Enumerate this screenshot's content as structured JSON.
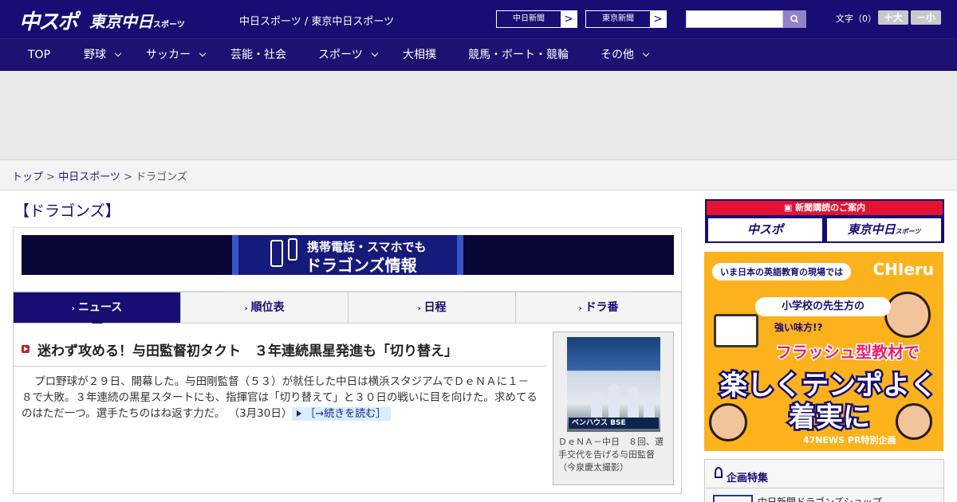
{
  "header": {
    "logo_chunichi_sports": "中スポ",
    "logo_tokyo_chunichi": "東京中日",
    "logo_tokyo_chunichi_sub": "スポーツ",
    "site_links": "中日スポーツ / 東京中日スポーツ",
    "btn_chunichi_shimbun": "中日新聞",
    "btn_tokyo_shimbun": "東京新聞",
    "btn_arrow": ">",
    "search_placeholder": "",
    "font_size_label": "文字（0）",
    "font_larger": "＋大",
    "font_smaller": "－小"
  },
  "nav": [
    {
      "label": "TOP",
      "has_menu": false
    },
    {
      "label": "野球",
      "has_menu": true
    },
    {
      "label": "サッカー",
      "has_menu": true
    },
    {
      "label": "芸能・社会",
      "has_menu": false
    },
    {
      "label": "スポーツ",
      "has_menu": true
    },
    {
      "label": "大相撲",
      "has_menu": false
    },
    {
      "label": "競馬・ボート・競輪",
      "has_menu": false
    },
    {
      "label": "その他",
      "has_menu": true
    }
  ],
  "breadcrumb": {
    "top": "トップ",
    "sep": " > ",
    "chunichi_sports": "中日スポーツ",
    "current": "ドラゴンズ"
  },
  "section_title": "【ドラゴンズ】",
  "banner": {
    "line1": "携帯電話・スマホでも",
    "line2": "ドラゴンズ情報"
  },
  "tabs": [
    {
      "label": "ニュース",
      "active": true
    },
    {
      "label": "順位表",
      "active": false
    },
    {
      "label": "日程",
      "active": false
    },
    {
      "label": "ドラ番",
      "active": false
    }
  ],
  "article": {
    "title": "迷わず攻める！与田監督初タクト　３年連続黒星発進も「切り替え」",
    "body": "プロ野球が２９日、開幕した。与田剛監督（５３）が就任した中日は横浜スタジアムでＤｅＮＡに１－８で大敗。３年連続の黒星スタートにも、指揮官は「切り替えて」と３０日の戦いに目を向けた。求めてるのはただ一つ。選手たちのはね返す力だ。",
    "date": "（3月30日）",
    "more": "［→続きを読む］",
    "photo_sign": "ベンハウス BSE",
    "caption": "ＤｅＮＡ－中日　８回、選手交代を告げる与田監督（今泉慶太撮影）"
  },
  "sidebar": {
    "subscription_header": "新聞購読のご案内",
    "sub_chunichi": "中スポ",
    "sub_tokyo": "東京中日",
    "sub_tokyo_small": "スポーツ",
    "ad": {
      "tag": "いま日本の英語教育の現場では",
      "brand": "CHIeru",
      "line1": "小学校の先生方の",
      "line2": "強い味方!?",
      "line3": "フラッシュ型教材で",
      "line4": "楽しくテンポよく",
      "line5": "着実に",
      "footer": "47NEWS PR特別企画"
    },
    "feature_title": "企画特集",
    "feature_item": "中日新聞ドラゴンズショップ"
  },
  "colors": {
    "brand_navy": "#170d73",
    "nav_bg": "#1e1171",
    "accent_red": "#e4132f",
    "ad_orange": "#fcb21c"
  }
}
